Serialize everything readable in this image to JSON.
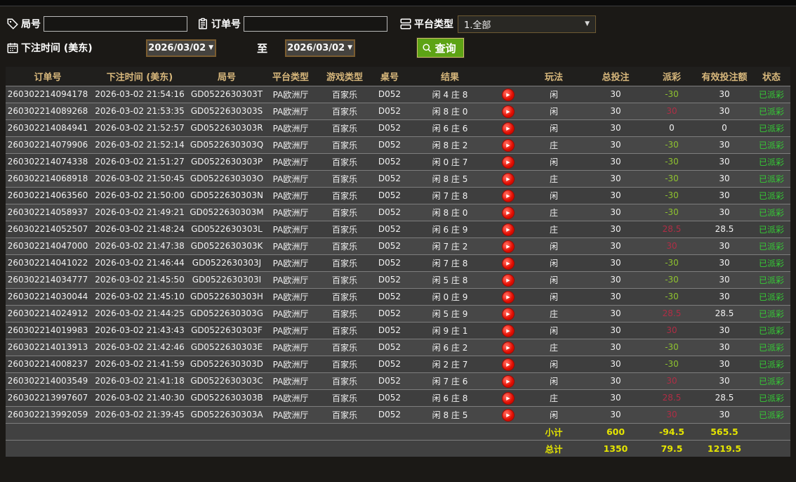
{
  "filters": {
    "game_no_label": "局号",
    "order_no_label": "订单号",
    "platform_label": "平台类型",
    "platform_value": "1.全部",
    "bet_time_label": "下注时间 (美东)",
    "date_from": "2026/03/02",
    "date_to": "2026/03/02",
    "to_label": "至",
    "query_label": "查询",
    "game_no_value": "",
    "order_no_value": ""
  },
  "colors": {
    "header_gold": "#d8b87c",
    "payout_positive_red": "#b02d45",
    "payout_negative_green": "#8fc32f",
    "status_green": "#35cb35",
    "summary_yellow": "#e4e400",
    "query_button_green": "#5da315"
  },
  "table": {
    "headers": [
      "订单号",
      "下注时间 (美东)",
      "局号",
      "平台类型",
      "游戏类型",
      "桌号",
      "结果",
      "",
      "玩法",
      "总投注",
      "派彩",
      "有效投注额",
      "状态"
    ],
    "rows": [
      {
        "order_no": "260302214094178",
        "bet_time": "2026-03-02 21:54:16",
        "game_no": "GD0522630303T",
        "platform": "PA欧洲厅",
        "game_type": "百家乐",
        "table_no": "D052",
        "result": "闲 4 庄 8",
        "play": "闲",
        "total_bet": "30",
        "payout": "-30",
        "valid_bet": "30",
        "status": "已派彩"
      },
      {
        "order_no": "260302214089268",
        "bet_time": "2026-03-02 21:53:35",
        "game_no": "GD0522630303S",
        "platform": "PA欧洲厅",
        "game_type": "百家乐",
        "table_no": "D052",
        "result": "闲 8 庄 0",
        "play": "闲",
        "total_bet": "30",
        "payout": "30",
        "valid_bet": "30",
        "status": "已派彩"
      },
      {
        "order_no": "260302214084941",
        "bet_time": "2026-03-02 21:52:57",
        "game_no": "GD0522630303R",
        "platform": "PA欧洲厅",
        "game_type": "百家乐",
        "table_no": "D052",
        "result": "闲 6 庄 6",
        "play": "闲",
        "total_bet": "30",
        "payout": "0",
        "valid_bet": "0",
        "status": "已派彩"
      },
      {
        "order_no": "260302214079906",
        "bet_time": "2026-03-02 21:52:14",
        "game_no": "GD0522630303Q",
        "platform": "PA欧洲厅",
        "game_type": "百家乐",
        "table_no": "D052",
        "result": "闲 8 庄 2",
        "play": "庄",
        "total_bet": "30",
        "payout": "-30",
        "valid_bet": "30",
        "status": "已派彩"
      },
      {
        "order_no": "260302214074338",
        "bet_time": "2026-03-02 21:51:27",
        "game_no": "GD0522630303P",
        "platform": "PA欧洲厅",
        "game_type": "百家乐",
        "table_no": "D052",
        "result": "闲 0 庄 7",
        "play": "闲",
        "total_bet": "30",
        "payout": "-30",
        "valid_bet": "30",
        "status": "已派彩"
      },
      {
        "order_no": "260302214068918",
        "bet_time": "2026-03-02 21:50:45",
        "game_no": "GD0522630303O",
        "platform": "PA欧洲厅",
        "game_type": "百家乐",
        "table_no": "D052",
        "result": "闲 8 庄 5",
        "play": "庄",
        "total_bet": "30",
        "payout": "-30",
        "valid_bet": "30",
        "status": "已派彩"
      },
      {
        "order_no": "260302214063560",
        "bet_time": "2026-03-02 21:50:00",
        "game_no": "GD0522630303N",
        "platform": "PA欧洲厅",
        "game_type": "百家乐",
        "table_no": "D052",
        "result": "闲 7 庄 8",
        "play": "闲",
        "total_bet": "30",
        "payout": "-30",
        "valid_bet": "30",
        "status": "已派彩"
      },
      {
        "order_no": "260302214058937",
        "bet_time": "2026-03-02 21:49:21",
        "game_no": "GD0522630303M",
        "platform": "PA欧洲厅",
        "game_type": "百家乐",
        "table_no": "D052",
        "result": "闲 8 庄 0",
        "play": "庄",
        "total_bet": "30",
        "payout": "-30",
        "valid_bet": "30",
        "status": "已派彩"
      },
      {
        "order_no": "260302214052507",
        "bet_time": "2026-03-02 21:48:24",
        "game_no": "GD0522630303L",
        "platform": "PA欧洲厅",
        "game_type": "百家乐",
        "table_no": "D052",
        "result": "闲 6 庄 9",
        "play": "庄",
        "total_bet": "30",
        "payout": "28.5",
        "valid_bet": "28.5",
        "status": "已派彩"
      },
      {
        "order_no": "260302214047000",
        "bet_time": "2026-03-02 21:47:38",
        "game_no": "GD0522630303K",
        "platform": "PA欧洲厅",
        "game_type": "百家乐",
        "table_no": "D052",
        "result": "闲 7 庄 2",
        "play": "闲",
        "total_bet": "30",
        "payout": "30",
        "valid_bet": "30",
        "status": "已派彩"
      },
      {
        "order_no": "260302214041022",
        "bet_time": "2026-03-02 21:46:44",
        "game_no": "GD0522630303J",
        "platform": "PA欧洲厅",
        "game_type": "百家乐",
        "table_no": "D052",
        "result": "闲 7 庄 8",
        "play": "闲",
        "total_bet": "30",
        "payout": "-30",
        "valid_bet": "30",
        "status": "已派彩"
      },
      {
        "order_no": "260302214034777",
        "bet_time": "2026-03-02 21:45:50",
        "game_no": "GD0522630303I",
        "platform": "PA欧洲厅",
        "game_type": "百家乐",
        "table_no": "D052",
        "result": "闲 5 庄 8",
        "play": "闲",
        "total_bet": "30",
        "payout": "-30",
        "valid_bet": "30",
        "status": "已派彩"
      },
      {
        "order_no": "260302214030044",
        "bet_time": "2026-03-02 21:45:10",
        "game_no": "GD0522630303H",
        "platform": "PA欧洲厅",
        "game_type": "百家乐",
        "table_no": "D052",
        "result": "闲 0 庄 9",
        "play": "闲",
        "total_bet": "30",
        "payout": "-30",
        "valid_bet": "30",
        "status": "已派彩"
      },
      {
        "order_no": "260302214024912",
        "bet_time": "2026-03-02 21:44:25",
        "game_no": "GD0522630303G",
        "platform": "PA欧洲厅",
        "game_type": "百家乐",
        "table_no": "D052",
        "result": "闲 5 庄 9",
        "play": "庄",
        "total_bet": "30",
        "payout": "28.5",
        "valid_bet": "28.5",
        "status": "已派彩"
      },
      {
        "order_no": "260302214019983",
        "bet_time": "2026-03-02 21:43:43",
        "game_no": "GD0522630303F",
        "platform": "PA欧洲厅",
        "game_type": "百家乐",
        "table_no": "D052",
        "result": "闲 9 庄 1",
        "play": "闲",
        "total_bet": "30",
        "payout": "30",
        "valid_bet": "30",
        "status": "已派彩"
      },
      {
        "order_no": "260302214013913",
        "bet_time": "2026-03-02 21:42:46",
        "game_no": "GD0522630303E",
        "platform": "PA欧洲厅",
        "game_type": "百家乐",
        "table_no": "D052",
        "result": "闲 6 庄 2",
        "play": "庄",
        "total_bet": "30",
        "payout": "-30",
        "valid_bet": "30",
        "status": "已派彩"
      },
      {
        "order_no": "260302214008237",
        "bet_time": "2026-03-02 21:41:59",
        "game_no": "GD0522630303D",
        "platform": "PA欧洲厅",
        "game_type": "百家乐",
        "table_no": "D052",
        "result": "闲 2 庄 7",
        "play": "闲",
        "total_bet": "30",
        "payout": "-30",
        "valid_bet": "30",
        "status": "已派彩"
      },
      {
        "order_no": "260302214003549",
        "bet_time": "2026-03-02 21:41:18",
        "game_no": "GD0522630303C",
        "platform": "PA欧洲厅",
        "game_type": "百家乐",
        "table_no": "D052",
        "result": "闲 7 庄 6",
        "play": "闲",
        "total_bet": "30",
        "payout": "30",
        "valid_bet": "30",
        "status": "已派彩"
      },
      {
        "order_no": "260302213997607",
        "bet_time": "2026-03-02 21:40:30",
        "game_no": "GD0522630303B",
        "platform": "PA欧洲厅",
        "game_type": "百家乐",
        "table_no": "D052",
        "result": "闲 6 庄 8",
        "play": "庄",
        "total_bet": "30",
        "payout": "28.5",
        "valid_bet": "28.5",
        "status": "已派彩"
      },
      {
        "order_no": "260302213992059",
        "bet_time": "2026-03-02 21:39:45",
        "game_no": "GD0522630303A",
        "platform": "PA欧洲厅",
        "game_type": "百家乐",
        "table_no": "D052",
        "result": "闲 8 庄 5",
        "play": "闲",
        "total_bet": "30",
        "payout": "30",
        "valid_bet": "30",
        "status": "已派彩"
      }
    ],
    "subtotal": {
      "label": "小计",
      "total_bet": "600",
      "payout": "-94.5",
      "valid_bet": "565.5"
    },
    "total": {
      "label": "总计",
      "total_bet": "1350",
      "payout": "79.5",
      "valid_bet": "1219.5"
    }
  }
}
